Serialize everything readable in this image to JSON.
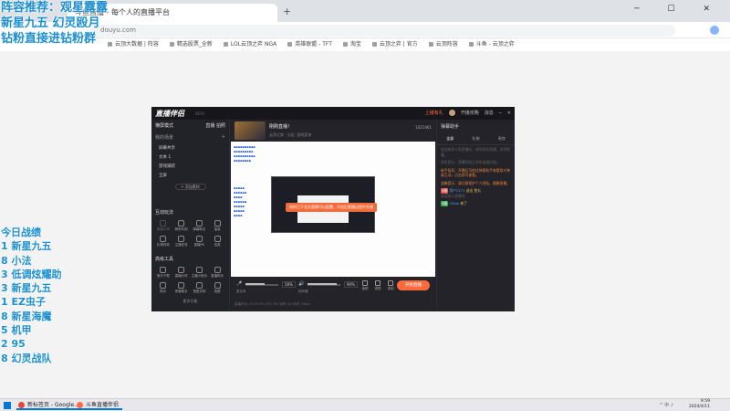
{
  "overlay": {
    "lines": [
      "阵容推荐：观星露露",
      "新星九五 幻灵殴月",
      "钻粉直接进钻粉群"
    ],
    "stats_title": "今日战绩",
    "stats": [
      "1 新星九五",
      "8 小法",
      "3 低调炫耀助",
      "3 新星九五",
      "1 EZ虫子",
      "8 新星海魔",
      "5 机甲",
      "2 95",
      "8 幻灵战队"
    ]
  },
  "browser": {
    "tab_title": "斗鱼直播 - 每个人的直播平台",
    "window_controls": "─ ☐ ✕",
    "address": "douyu.com",
    "bookmarks": [
      "云顶大数据 | 阵容",
      "精选股票_全新",
      "LOL云顶之弈 NGA",
      "英雄联盟 - TFT",
      "淘宝",
      "云顶之弈 | 官方",
      "云顶阵容",
      "斗鱼 - 云顶之弈"
    ]
  },
  "app": {
    "logo": "直播伴侣",
    "logo_sub": "BETA",
    "title_actions": [
      "上播有礼",
      "开播攻略",
      "消息"
    ],
    "scene_mode": "横屏模式",
    "left_tabs": [
      "直播",
      "拍照"
    ],
    "sources_header": "我的场景",
    "sources": [
      "屏幕共享",
      "文本 1",
      "游戏捕获",
      "全屏"
    ],
    "add_source": "+ 添加素材",
    "interact_header": "互动玩法",
    "interact_tools": [
      "屏幕分享",
      "精彩时刻",
      "弹幕助手",
      "抽奖"
    ],
    "interact_tools2": [
      "礼物特效",
      "主播任务",
      "直播PK",
      "连麦"
    ],
    "advanced_header": "高级工具",
    "advanced_tools": [
      "音乐下载",
      "直播计时",
      "主播小助手",
      "直播助手"
    ],
    "advanced_tools2": [
      "助手",
      "房管助手",
      "语音识别",
      "录屏"
    ],
    "more": "更多功能",
    "stream_title": "刚刚直播！",
    "stream_tags": "云顶之弈 · 分区: 游戏竞技",
    "stream_id": "1021461",
    "toast": "斜你已下北京直播可以配置，开启后直播过程中开播",
    "mic_pct": "58%",
    "speaker_pct": "90%",
    "mic_label": "麦克风",
    "speaker_label": "扬声器",
    "ctrl_icons": [
      "美颜",
      "滤镜",
      "录制"
    ],
    "start_button": "开始直播",
    "status_line": "直播时长: 00:00:00    CPU: 8%    帧率: 60    码率: 0kb/s",
    "chat_title": "弹幕助手",
    "chat_tabs": [
      "全部",
      "礼物",
      "贵宾"
    ],
    "chat": [
      {
        "type": "grey",
        "text": "欢迎来到斗鱼直播间，倡导绿色直播，文明观看。"
      },
      {
        "type": "grey",
        "text": "系统提示：直播间禁止发布违规内容。"
      },
      {
        "type": "orange",
        "text": "新手指导：开播后可前往弹幕助手查看观众弹幕互动，点击即可查看。"
      },
      {
        "type": "orange",
        "text": "温馨提示：请注意保护个人隐私，健康直播。"
      },
      {
        "type": "gift",
        "badge": "5级",
        "name": "用户1271",
        "text": "送出 鱼丸"
      },
      {
        "type": "grey",
        "text": "欢迎进入直播间"
      },
      {
        "type": "gift",
        "badge": "3级",
        "name": "Chloe",
        "text": "来了",
        "green": true
      }
    ]
  },
  "taskbar": {
    "apps": [
      "新标签页 - Google...",
      "斗鱼直播伴侣"
    ],
    "time": "9:59",
    "date": "2024/4/11",
    "tray": "^ 中 ♪"
  }
}
